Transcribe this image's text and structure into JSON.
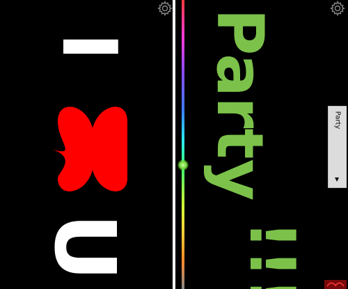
{
  "left_panel": {
    "letter_top": "I",
    "letter_bottom": "U",
    "heart_color": "#ff0000",
    "text_color": "#ffffff",
    "settings_icon": "gear-icon"
  },
  "right_panel": {
    "word": "Party",
    "exclamation": "!!!",
    "text_color": "#7cc24a",
    "settings_icon": "gear-icon",
    "color_slider": {
      "value_fraction": 0.57
    },
    "side_tab": {
      "label": "Party",
      "arrow": "▼"
    }
  }
}
